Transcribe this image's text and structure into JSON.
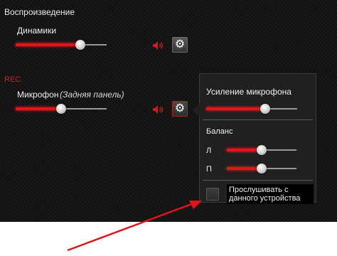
{
  "playback": {
    "title": "Воспроизведение",
    "device_label": "Динамики",
    "volume": 0.71
  },
  "recording": {
    "rec_label": "REC",
    "device_label": "Микрофон",
    "device_sub": "(Задняя панель)",
    "volume": 0.5
  },
  "popup": {
    "boost_label": "Усиление микрофона",
    "boost_level": 0.65,
    "balance_label": "Баланс",
    "left_label": "Л",
    "left_level": 0.5,
    "right_label": "П",
    "right_level": 0.5,
    "listen_label": "Прослушивать с данного устройства",
    "listen_checked": false
  },
  "colors": {
    "accent": "#e0141a",
    "background": "#151515",
    "annotation_arrow": "#e0141a"
  },
  "icons": {
    "speaker": "speaker-icon",
    "settings": "gear-icon"
  }
}
